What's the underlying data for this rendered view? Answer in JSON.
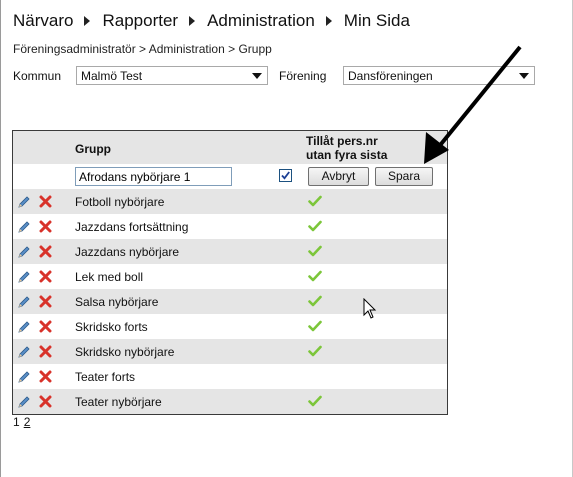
{
  "nav": {
    "items": [
      "Närvaro",
      "Rapporter",
      "Administration",
      "Min Sida"
    ]
  },
  "breadcrumb": "Föreningsadministratör > Administration > Grupp",
  "filters": {
    "kommun_label": "Kommun",
    "kommun_value": "Malmö Test",
    "forening_label": "Förening",
    "forening_value": "Dansföreningen"
  },
  "grid": {
    "header_grupp": "Grupp",
    "header_tillat_line1": "Tillåt pers.nr",
    "header_tillat_line2": "utan fyra sista",
    "edit": {
      "value": "Afrodans nybörjare 1",
      "checked": true,
      "cancel_label": "Avbryt",
      "save_label": "Spara"
    },
    "rows": [
      {
        "name": "Fotboll nybörjare",
        "allowed": true
      },
      {
        "name": "Jazzdans fortsättning",
        "allowed": true
      },
      {
        "name": "Jazzdans nybörjare",
        "allowed": true
      },
      {
        "name": "Lek med boll",
        "allowed": true
      },
      {
        "name": "Salsa nybörjare",
        "allowed": true
      },
      {
        "name": "Skridsko forts",
        "allowed": true
      },
      {
        "name": "Skridsko nybörjare",
        "allowed": true
      },
      {
        "name": "Teater forts",
        "allowed": false
      },
      {
        "name": "Teater nybörjare",
        "allowed": true
      }
    ]
  },
  "pager": {
    "current": "1",
    "next": "2"
  },
  "colors": {
    "row_alt": "#e5e5e5",
    "check_green": "#7cc63a",
    "delete_red": "#d8322a"
  }
}
